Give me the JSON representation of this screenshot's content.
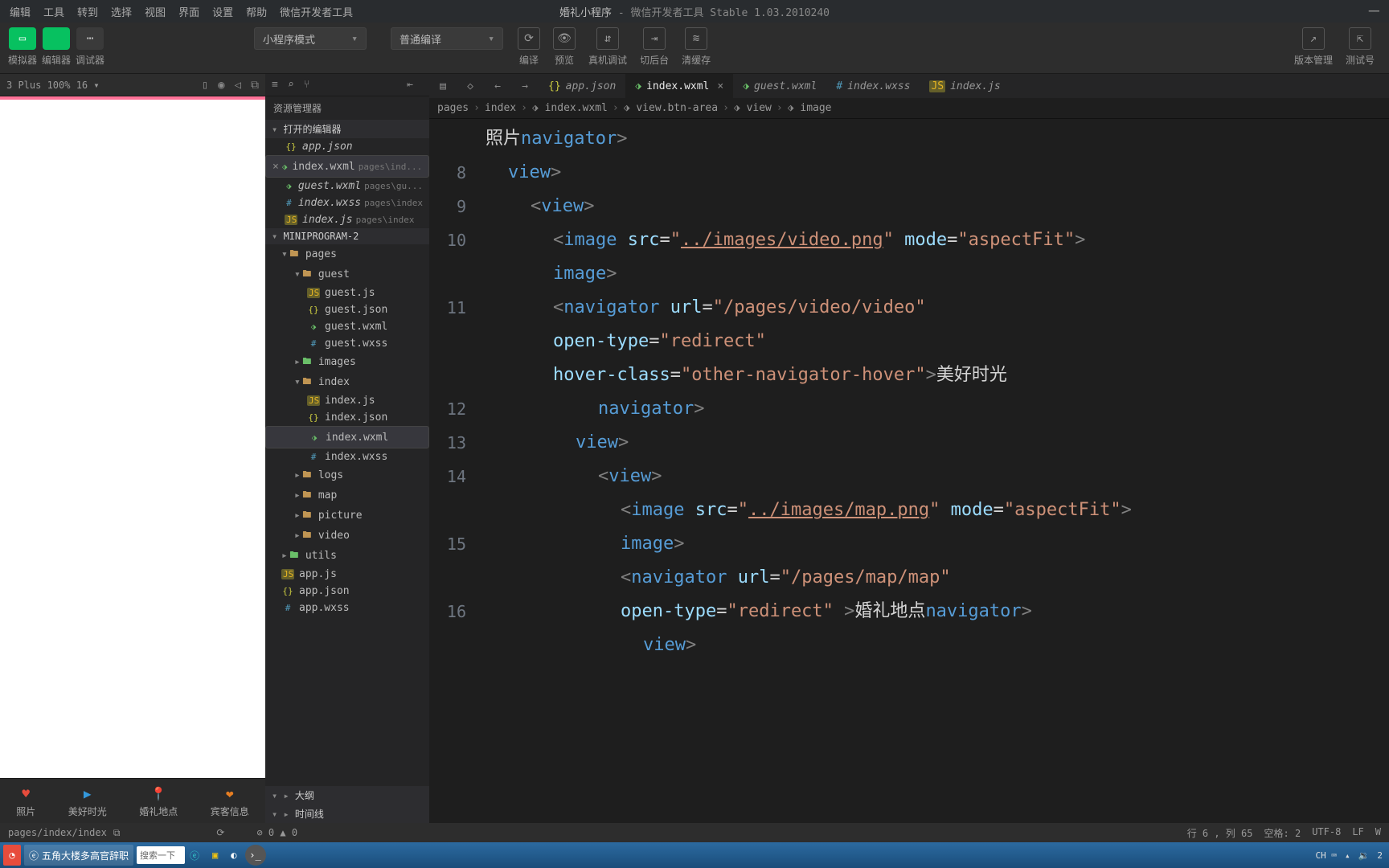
{
  "menubar": {
    "items": [
      "编辑",
      "工具",
      "转到",
      "选择",
      "视图",
      "界面",
      "设置",
      "帮助",
      "微信开发者工具"
    ],
    "title_bold": "婚礼小程序",
    "title_rest": " - 微信开发者工具 Stable 1.03.2010240"
  },
  "actionbar": {
    "left": [
      {
        "ic": "▭",
        "lbl": "模拟器",
        "cls": "green"
      },
      {
        "ic": "</>",
        "lbl": "编辑器",
        "cls": "green"
      },
      {
        "ic": "⋯",
        "lbl": "调试器",
        "cls": "grey"
      }
    ],
    "mode": "小程序模式",
    "compile": "普通编译",
    "tools": [
      {
        "ic": "⟳",
        "lbl": "编译"
      },
      {
        "ic": "👁",
        "lbl": "预览"
      },
      {
        "ic": "⇵",
        "lbl": "真机调试"
      },
      {
        "ic": "⇥",
        "lbl": "切后台"
      },
      {
        "ic": "≋",
        "lbl": "清缓存"
      }
    ],
    "right": [
      {
        "ic": "↗",
        "lbl": "版本管理"
      },
      {
        "ic": "⇱",
        "lbl": "测试号"
      }
    ]
  },
  "simbar": {
    "device": "3 Plus 100% 16 ▾"
  },
  "simnav": [
    {
      "ic": "♥",
      "color": "#e74c3c",
      "lbl": "照片"
    },
    {
      "ic": "▶",
      "color": "#3498db",
      "lbl": "美好时光"
    },
    {
      "ic": "📍",
      "color": "#3498db",
      "lbl": "婚礼地点"
    },
    {
      "ic": "❤",
      "color": "#e67e22",
      "lbl": "宾客信息"
    }
  ],
  "explorer": {
    "title": "资源管理器",
    "open_group": "打开的编辑器",
    "open": [
      {
        "fi": "{}",
        "cls": "fi-json",
        "name": "app.json"
      },
      {
        "fi": "⬗",
        "cls": "fi-wxml",
        "name": "index.wxml",
        "path": "pages\\ind...",
        "sel": true,
        "closable": true
      },
      {
        "fi": "⬗",
        "cls": "fi-wxml",
        "name": "guest.wxml",
        "path": "pages\\gu..."
      },
      {
        "fi": "#",
        "cls": "fi-wxss",
        "name": "index.wxss",
        "path": "pages\\index"
      },
      {
        "fi": "JS",
        "cls": "fi-js",
        "name": "index.js",
        "path": "pages\\index"
      }
    ],
    "project": "MINIPROGRAM-2",
    "tree": [
      {
        "d": 1,
        "exp": true,
        "fi": "▸",
        "cls": "fi-fold",
        "name": "pages",
        "isGroup": true
      },
      {
        "d": 2,
        "exp": true,
        "fi": "▸",
        "cls": "fi-fold",
        "name": "guest",
        "isGroup": true
      },
      {
        "d": 3,
        "fi": "JS",
        "cls": "fi-js",
        "name": "guest.js"
      },
      {
        "d": 3,
        "fi": "{}",
        "cls": "fi-json",
        "name": "guest.json"
      },
      {
        "d": 3,
        "fi": "⬗",
        "cls": "fi-wxml",
        "name": "guest.wxml"
      },
      {
        "d": 3,
        "fi": "#",
        "cls": "fi-wxss",
        "name": "guest.wxss"
      },
      {
        "d": 2,
        "fi": "▸",
        "cls": "fi-foldg",
        "name": "images",
        "isGroup": true,
        "collapsed": true
      },
      {
        "d": 2,
        "exp": true,
        "fi": "▸",
        "cls": "fi-fold",
        "name": "index",
        "isGroup": true
      },
      {
        "d": 3,
        "fi": "JS",
        "cls": "fi-js",
        "name": "index.js"
      },
      {
        "d": 3,
        "fi": "{}",
        "cls": "fi-json",
        "name": "index.json"
      },
      {
        "d": 3,
        "fi": "⬗",
        "cls": "fi-wxml",
        "name": "index.wxml",
        "sel": true
      },
      {
        "d": 3,
        "fi": "#",
        "cls": "fi-wxss",
        "name": "index.wxss"
      },
      {
        "d": 2,
        "fi": "▸",
        "cls": "fi-fold",
        "name": "logs",
        "isGroup": true,
        "collapsed": true
      },
      {
        "d": 2,
        "fi": "▸",
        "cls": "fi-fold",
        "name": "map",
        "isGroup": true,
        "collapsed": true
      },
      {
        "d": 2,
        "fi": "▸",
        "cls": "fi-fold",
        "name": "picture",
        "isGroup": true,
        "collapsed": true
      },
      {
        "d": 2,
        "fi": "▸",
        "cls": "fi-fold",
        "name": "video",
        "isGroup": true,
        "collapsed": true
      },
      {
        "d": 1,
        "fi": "▸",
        "cls": "fi-foldg",
        "name": "utils",
        "isGroup": true,
        "collapsed": true
      },
      {
        "d": 1,
        "fi": "JS",
        "cls": "fi-js",
        "name": "app.js"
      },
      {
        "d": 1,
        "fi": "{}",
        "cls": "fi-json",
        "name": "app.json"
      },
      {
        "d": 1,
        "fi": "#",
        "cls": "fi-wxss",
        "name": "app.wxss"
      }
    ],
    "bottom": [
      "大纲",
      "时间线"
    ]
  },
  "tabs": [
    {
      "fi": "{}",
      "cls": "fi-json",
      "name": "app.json"
    },
    {
      "fi": "⬗",
      "cls": "fi-wxml",
      "name": "index.wxml",
      "active": true
    },
    {
      "fi": "⬗",
      "cls": "fi-wxml",
      "name": "guest.wxml",
      "italic": true
    },
    {
      "fi": "#",
      "cls": "fi-wxss",
      "name": "index.wxss"
    },
    {
      "fi": "JS",
      "cls": "fi-js",
      "name": "index.js"
    }
  ],
  "crumbs": [
    "pages",
    "index",
    "index.wxml",
    "view.btn-area",
    "view",
    "image"
  ],
  "gutter": [
    "",
    "8",
    "9",
    "10",
    "",
    "11",
    "",
    "",
    "12",
    "13",
    "14",
    "",
    "15",
    "",
    "16"
  ],
  "code": [
    [
      [
        "txt",
        "照片"
      ],
      [
        "br",
        "</"
      ],
      [
        "tag",
        "navigator"
      ],
      [
        "br",
        ">"
      ]
    ],
    [
      [
        "ind",
        1
      ],
      [
        "br",
        "</"
      ],
      [
        "tag",
        "view"
      ],
      [
        "br",
        ">"
      ]
    ],
    [
      [
        "ind",
        1
      ],
      [
        "br",
        "<"
      ],
      [
        "tag",
        "view"
      ],
      [
        "br",
        ">"
      ]
    ],
    [
      [
        "ind",
        2
      ],
      [
        "br",
        "<"
      ],
      [
        "tag",
        "image"
      ],
      [
        "txt",
        " "
      ],
      [
        "attr",
        "src"
      ],
      [
        "txt",
        "="
      ],
      [
        "str",
        "\""
      ],
      [
        "link",
        "../images/video.png"
      ],
      [
        "str",
        "\""
      ],
      [
        "txt",
        " "
      ],
      [
        "attr",
        "mode"
      ],
      [
        "txt",
        "="
      ],
      [
        "str",
        "\"aspectFit\""
      ],
      [
        "br",
        ">"
      ]
    ],
    [
      [
        "ind",
        2
      ],
      [
        "tag",
        "image"
      ],
      [
        "br",
        ">"
      ]
    ],
    [
      [
        "ind",
        2
      ],
      [
        "br",
        "<"
      ],
      [
        "tag",
        "navigator"
      ],
      [
        "txt",
        " "
      ],
      [
        "attr",
        "url"
      ],
      [
        "txt",
        "="
      ],
      [
        "str",
        "\"/pages/video/video\""
      ]
    ],
    [
      [
        "ind",
        2
      ],
      [
        "attr",
        "open-type"
      ],
      [
        "txt",
        "="
      ],
      [
        "str",
        "\"redirect\""
      ]
    ],
    [
      [
        "ind",
        2
      ],
      [
        "attr",
        "hover-class"
      ],
      [
        "txt",
        "="
      ],
      [
        "str",
        "\"other-navigator-hover\""
      ],
      [
        "br",
        ">"
      ],
      [
        "txt",
        "美好时光"
      ],
      [
        "br",
        "</"
      ]
    ],
    [
      [
        "ind",
        2
      ],
      [
        "tag",
        "navigator"
      ],
      [
        "br",
        ">"
      ]
    ],
    [
      [
        "ind",
        1
      ],
      [
        "br",
        "</"
      ],
      [
        "tag",
        "view"
      ],
      [
        "br",
        ">"
      ]
    ],
    [
      [
        "ind",
        1
      ],
      [
        "br",
        "<"
      ],
      [
        "tag",
        "view"
      ],
      [
        "br",
        ">"
      ]
    ],
    [
      [
        "ind",
        2
      ],
      [
        "br",
        "<"
      ],
      [
        "tag",
        "image"
      ],
      [
        "txt",
        " "
      ],
      [
        "attr",
        "src"
      ],
      [
        "txt",
        "="
      ],
      [
        "str",
        "\""
      ],
      [
        "link",
        "../images/map.png"
      ],
      [
        "str",
        "\""
      ],
      [
        "txt",
        " "
      ],
      [
        "attr",
        "mode"
      ],
      [
        "txt",
        "="
      ],
      [
        "str",
        "\"aspectFit\""
      ],
      [
        "br",
        ">"
      ]
    ],
    [
      [
        "ind",
        2
      ],
      [
        "tag",
        "image"
      ],
      [
        "br",
        ">"
      ]
    ],
    [
      [
        "ind",
        2
      ],
      [
        "br",
        "<"
      ],
      [
        "tag",
        "navigator"
      ],
      [
        "txt",
        " "
      ],
      [
        "attr",
        "url"
      ],
      [
        "txt",
        "="
      ],
      [
        "str",
        "\"/pages/map/map\""
      ]
    ],
    [
      [
        "ind",
        2
      ],
      [
        "attr",
        "open-type"
      ],
      [
        "txt",
        "="
      ],
      [
        "str",
        "\"redirect\""
      ],
      [
        "txt",
        " "
      ],
      [
        "br",
        ">"
      ],
      [
        "txt",
        "婚礼地点"
      ],
      [
        "br",
        "</"
      ],
      [
        "tag",
        "navigator"
      ],
      [
        "br",
        ">"
      ]
    ],
    [
      [
        "ind",
        1
      ],
      [
        "br",
        "</"
      ],
      [
        "tag",
        "view"
      ],
      [
        "br",
        ">"
      ]
    ]
  ],
  "status1": {
    "path": "pages/index/index",
    "problems": "⊘ 0  ▲ 0",
    "cursor": "行 6 , 列 65",
    "spaces": "空格: 2",
    "enc": "UTF-8",
    "eol": "LF"
  },
  "taskbar": {
    "apps": [
      "五角大楼多高官辞职"
    ],
    "search": "搜索一下",
    "ime": "CH ⌨",
    "time": "2"
  }
}
